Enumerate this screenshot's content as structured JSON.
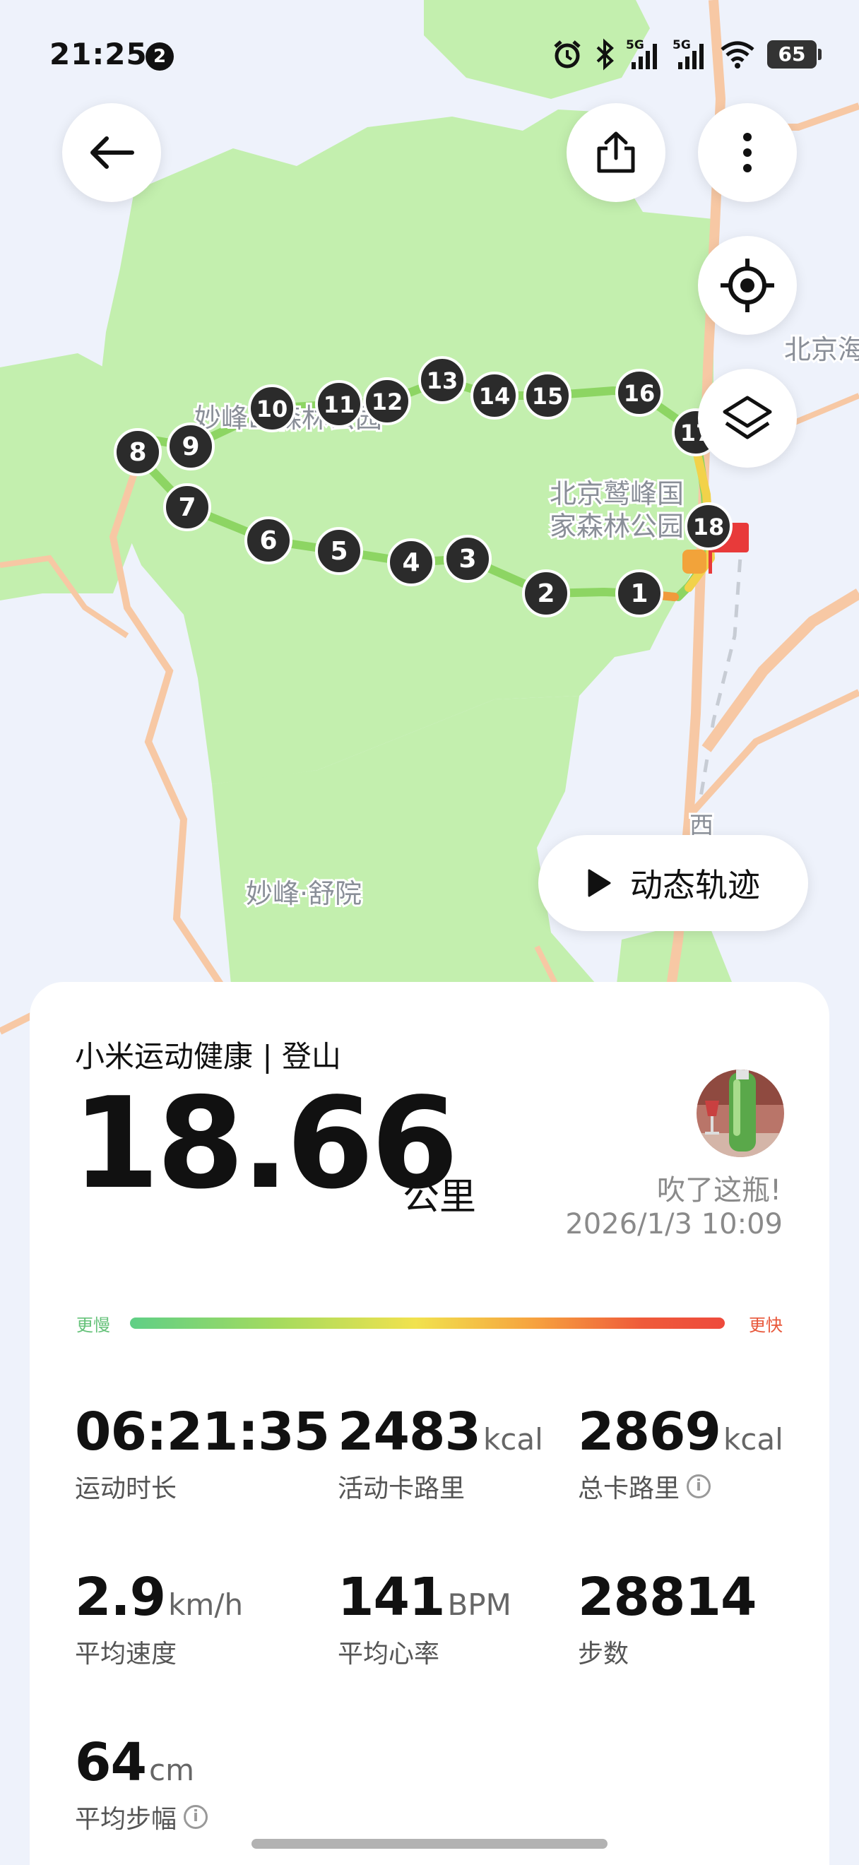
{
  "status_bar": {
    "time": "21:25",
    "notification_count": "2",
    "battery": "65",
    "net1": "5G",
    "net2": "5G",
    "icons": [
      "alarm-icon",
      "bluetooth-icon",
      "signal-5g-icon",
      "signal-5g-icon",
      "wifi-icon",
      "battery-icon"
    ]
  },
  "map": {
    "labels": {
      "park_west": "妙峰山森林公园",
      "park_east_1": "北京鹫峰国",
      "park_east_2": "家森林公园",
      "beijing_edge": "北京海",
      "shuyuan": "妙峰·舒院",
      "xi": "西"
    },
    "markers": [
      "1",
      "2",
      "3",
      "4",
      "5",
      "6",
      "7",
      "8",
      "9",
      "10",
      "11",
      "12",
      "13",
      "14",
      "15",
      "16",
      "17",
      "18"
    ],
    "buttons": [
      "back-icon",
      "share-icon",
      "more-icon",
      "locate-icon",
      "layers-icon"
    ],
    "play_label": "动态轨迹",
    "colors": {
      "forest": "#c3efae",
      "road": "#f7c8a4",
      "route": "#8dd563",
      "marker": "#2b2b2b",
      "flag": "#e83a3a"
    }
  },
  "card": {
    "subtitle": "小米运动健康 | 登山",
    "distance": "18.66",
    "distance_unit": "公里",
    "note": "吹了这瓶!",
    "datetime": "2026/1/3 10:09",
    "speed_slow": "更慢",
    "speed_fast": "更快",
    "stats": [
      {
        "value": "06:21:35",
        "unit": "",
        "label": "运动时长",
        "info": false
      },
      {
        "value": "2483",
        "unit": "kcal",
        "label": "活动卡路里",
        "info": false
      },
      {
        "value": "2869",
        "unit": "kcal",
        "label": "总卡路里",
        "info": true
      },
      {
        "value": "2.9",
        "unit": "km/h",
        "label": "平均速度",
        "info": false
      },
      {
        "value": "141",
        "unit": "BPM",
        "label": "平均心率",
        "info": false
      },
      {
        "value": "28814",
        "unit": "",
        "label": "步数",
        "info": false
      },
      {
        "value": "64",
        "unit": "cm",
        "label": "平均步幅",
        "info": true
      }
    ],
    "info_glyph": "i"
  }
}
